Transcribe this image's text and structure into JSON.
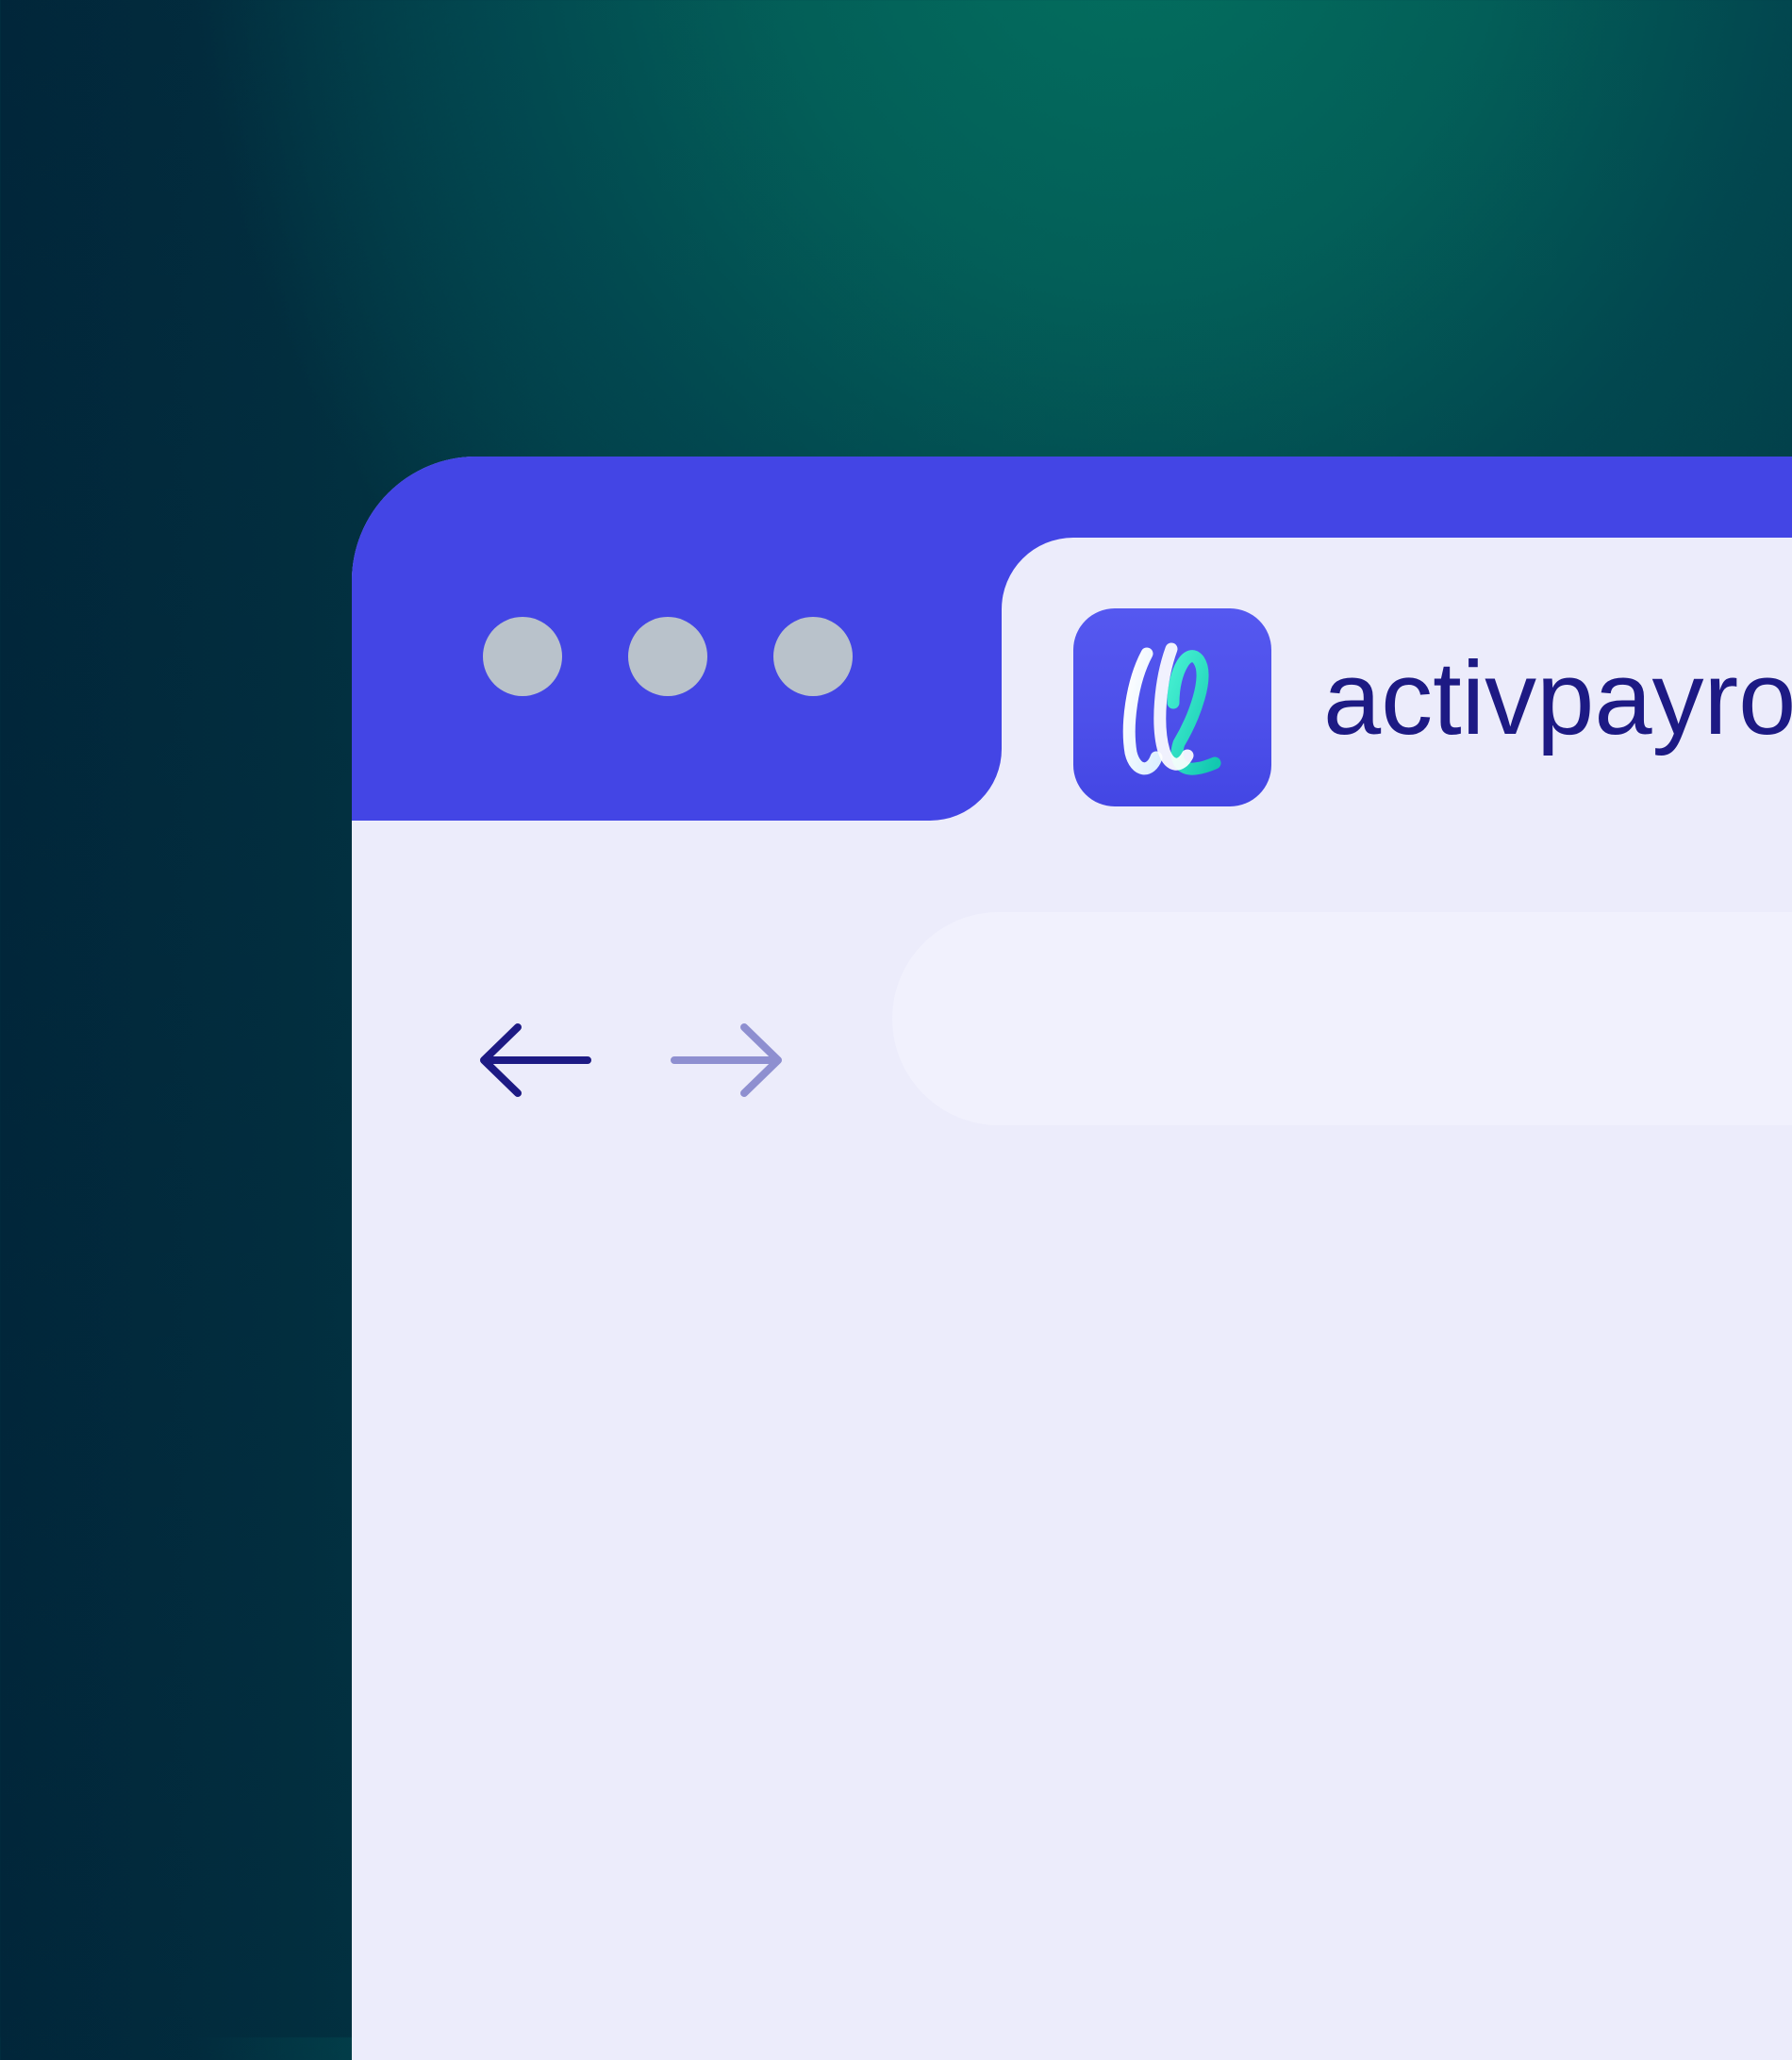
{
  "window": {
    "controls": [
      {
        "name": "close",
        "color": "#b9c2cb"
      },
      {
        "name": "minimize",
        "color": "#b9c2cb"
      },
      {
        "name": "maximize",
        "color": "#b9c2cb"
      }
    ],
    "titlebar_color": "#4345e5",
    "body_color": "#ececfb"
  },
  "tab": {
    "title": "activpayroll",
    "icon": "activpayroll-logo-icon",
    "text_color": "#1d1a84"
  },
  "navigation": {
    "back": {
      "icon": "arrow-left-icon",
      "color": "#1d1a84",
      "enabled": true
    },
    "forward": {
      "icon": "arrow-right-icon",
      "color": "#8e8fd0",
      "enabled": false
    }
  },
  "address_bar": {
    "value": "",
    "color": "#f1f1fd"
  },
  "background": {
    "accent": "#03705f",
    "dark": "#01263a"
  }
}
